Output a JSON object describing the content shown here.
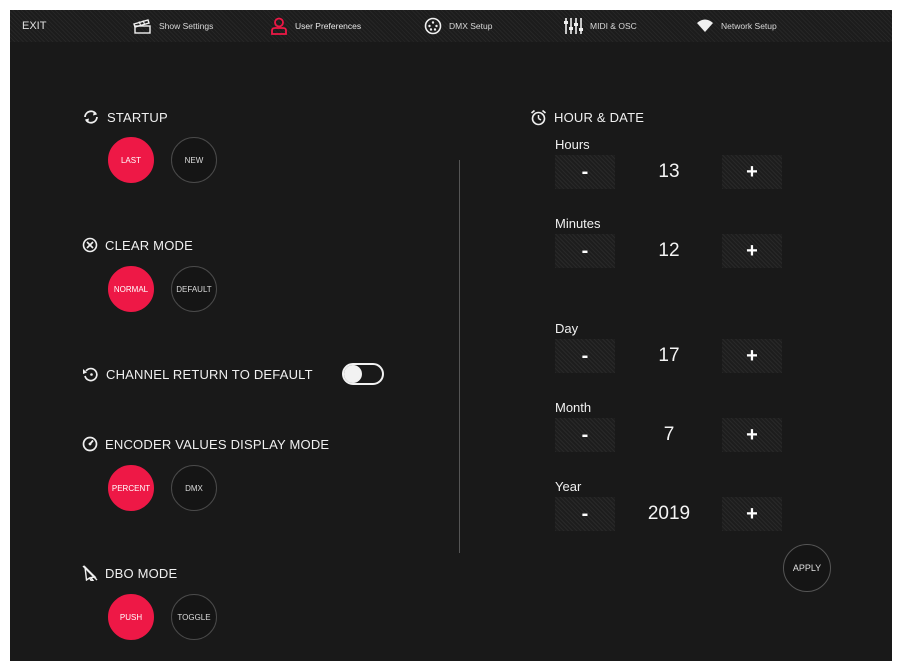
{
  "topbar": {
    "exit": "EXIT",
    "tabs": [
      {
        "label": "Show Settings",
        "icon": "show-settings-icon"
      },
      {
        "label": "User Preferences",
        "icon": "user-icon"
      },
      {
        "label": "DMX Setup",
        "icon": "dmx-connector-icon"
      },
      {
        "label": "MIDI & OSC",
        "icon": "sliders-icon"
      },
      {
        "label": "Network Setup",
        "icon": "wifi-icon"
      }
    ],
    "active_tab": "User Preferences"
  },
  "preferences": {
    "startup": {
      "title": "STARTUP",
      "options": [
        "LAST",
        "NEW"
      ],
      "selected": "LAST"
    },
    "clear_mode": {
      "title": "CLEAR MODE",
      "options": [
        "NORMAL",
        "DEFAULT"
      ],
      "selected": "NORMAL"
    },
    "channel_return": {
      "title": "CHANNEL RETURN TO DEFAULT",
      "enabled": false
    },
    "encoder_mode": {
      "title": "ENCODER VALUES DISPLAY MODE",
      "options": [
        "PERCENT",
        "DMX"
      ],
      "selected": "PERCENT"
    },
    "dbo_mode": {
      "title": "DBO MODE",
      "options": [
        "PUSH",
        "TOGGLE"
      ],
      "selected": "PUSH"
    }
  },
  "hour_date": {
    "title": "HOUR & DATE",
    "decrement_label": "-",
    "increment_label": "+",
    "fields": [
      {
        "label": "Hours",
        "value": "13"
      },
      {
        "label": "Minutes",
        "value": "12"
      },
      {
        "label": "Day",
        "value": "17"
      },
      {
        "label": "Month",
        "value": "7"
      },
      {
        "label": "Year",
        "value": "2019"
      }
    ],
    "apply_label": "APPLY"
  },
  "colors": {
    "accent": "#ee1846",
    "background": "#191919",
    "text": "#f0f0f0"
  }
}
